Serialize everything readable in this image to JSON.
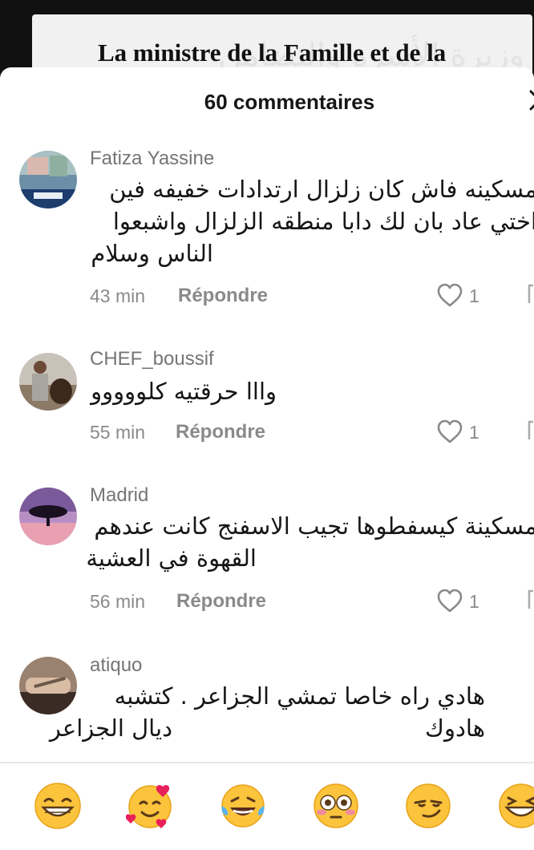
{
  "video": {
    "caption": "La ministre de la Famille et de la",
    "caption_ghost": "وزيرة الأسرة والتضامن"
  },
  "sheet": {
    "title": "60 commentaires",
    "close_icon": "close-icon"
  },
  "comments": [
    {
      "username": "Fatiza Yassine",
      "lines": [
        "مسكينه فاش كان زلزال ارتدادات خفيفه فين",
        "اختي عاد بان لك دابا منطقه الزلزال واشبعوا",
        "الناس وسلام"
      ],
      "time": "43 min",
      "reply": "Répondre",
      "likes": "1"
    },
    {
      "username": "CHEF_boussif",
      "lines": [
        "وااا حرقتيه كلووووو"
      ],
      "time": "55 min",
      "reply": "Répondre",
      "likes": "1"
    },
    {
      "username": "Madrid",
      "lines": [
        "مسكينة كيسفطوها تجيب الاسفنج كانت عندهم",
        "القهوة في العشية"
      ],
      "time": "56 min",
      "reply": "Répondre",
      "likes": "1"
    },
    {
      "username": "atiquo",
      "lines": [
        "هادي راه خاصا تمشي الجزاعر . كتشبه هادوك",
        "ديال الجزاعر"
      ],
      "time": "",
      "reply": "",
      "likes": ""
    }
  ],
  "emoji_bar": [
    {
      "icon": "grinning-face-icon",
      "char": "😁"
    },
    {
      "icon": "smiling-face-with-hearts-icon",
      "char": "🥰"
    },
    {
      "icon": "tears-of-joy-icon",
      "char": "😂"
    },
    {
      "icon": "flushed-face-icon",
      "char": "😳"
    },
    {
      "icon": "smirking-face-icon",
      "char": "😏"
    },
    {
      "icon": "grinning-squint-icon",
      "char": "😆"
    }
  ],
  "colors": {
    "text": "#161616",
    "muted": "#8a8a8a",
    "username": "#757575"
  }
}
